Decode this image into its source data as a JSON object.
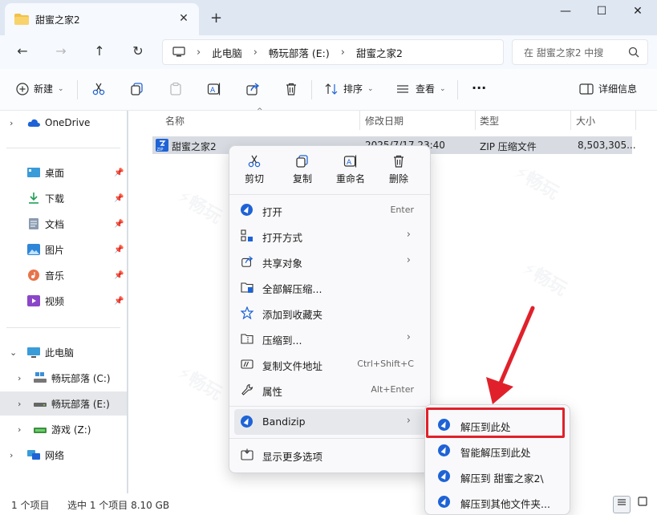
{
  "tab": {
    "title": "甜蜜之家2",
    "close": "✕",
    "new_tab": "+"
  },
  "window_controls": {
    "minimize": "—",
    "maximize": "☐",
    "close": "✕"
  },
  "nav": {
    "back": "←",
    "forward": "→",
    "up": "↑",
    "refresh": "↻"
  },
  "breadcrumb": [
    "此电脑",
    "畅玩部落 (E:)",
    "甜蜜之家2"
  ],
  "search": {
    "placeholder": "在 甜蜜之家2 中搜"
  },
  "toolbar": {
    "new_label": "新建",
    "sort_label": "排序",
    "view_label": "查看",
    "more_label": "···",
    "details_label": "详细信息"
  },
  "sidebar": {
    "onedrive": "OneDrive",
    "quick": [
      {
        "label": "桌面"
      },
      {
        "label": "下载"
      },
      {
        "label": "文档"
      },
      {
        "label": "图片"
      },
      {
        "label": "音乐"
      },
      {
        "label": "视频"
      }
    ],
    "this_pc": "此电脑",
    "drives": [
      {
        "label": "畅玩部落 (C:)"
      },
      {
        "label": "畅玩部落 (E:)"
      },
      {
        "label": "游戏 (Z:)"
      }
    ],
    "network": "网络"
  },
  "columns": {
    "name": "名称",
    "date": "修改日期",
    "type": "类型",
    "size": "大小"
  },
  "file": {
    "name": "甜蜜之家2",
    "date": "2025/7/17 23:40",
    "type": "ZIP 压缩文件",
    "size": "8,503,305..."
  },
  "context_menu": {
    "tools": [
      "剪切",
      "复制",
      "重命名",
      "删除"
    ],
    "items": [
      {
        "label": "打开",
        "shortcut": "Enter"
      },
      {
        "label": "打开方式",
        "submenu": true
      },
      {
        "label": "共享对象",
        "submenu": true
      },
      {
        "label": "全部解压缩..."
      },
      {
        "label": "添加到收藏夹"
      },
      {
        "label": "压缩到...",
        "submenu": true
      },
      {
        "label": "复制文件地址",
        "shortcut": "Ctrl+Shift+C"
      },
      {
        "label": "属性",
        "shortcut": "Alt+Enter"
      },
      {
        "label": "Bandizip",
        "submenu": true
      },
      {
        "label": "显示更多选项"
      }
    ]
  },
  "submenu": [
    "解压到此处",
    "智能解压到此处",
    "解压到 甜蜜之家2\\",
    "解压到其他文件夹..."
  ],
  "status": {
    "count": "1 个项目",
    "selected": "选中 1 个项目  8.10 GB"
  },
  "colors": {
    "accent": "#1e63d6",
    "highlight": "#e0212b"
  }
}
